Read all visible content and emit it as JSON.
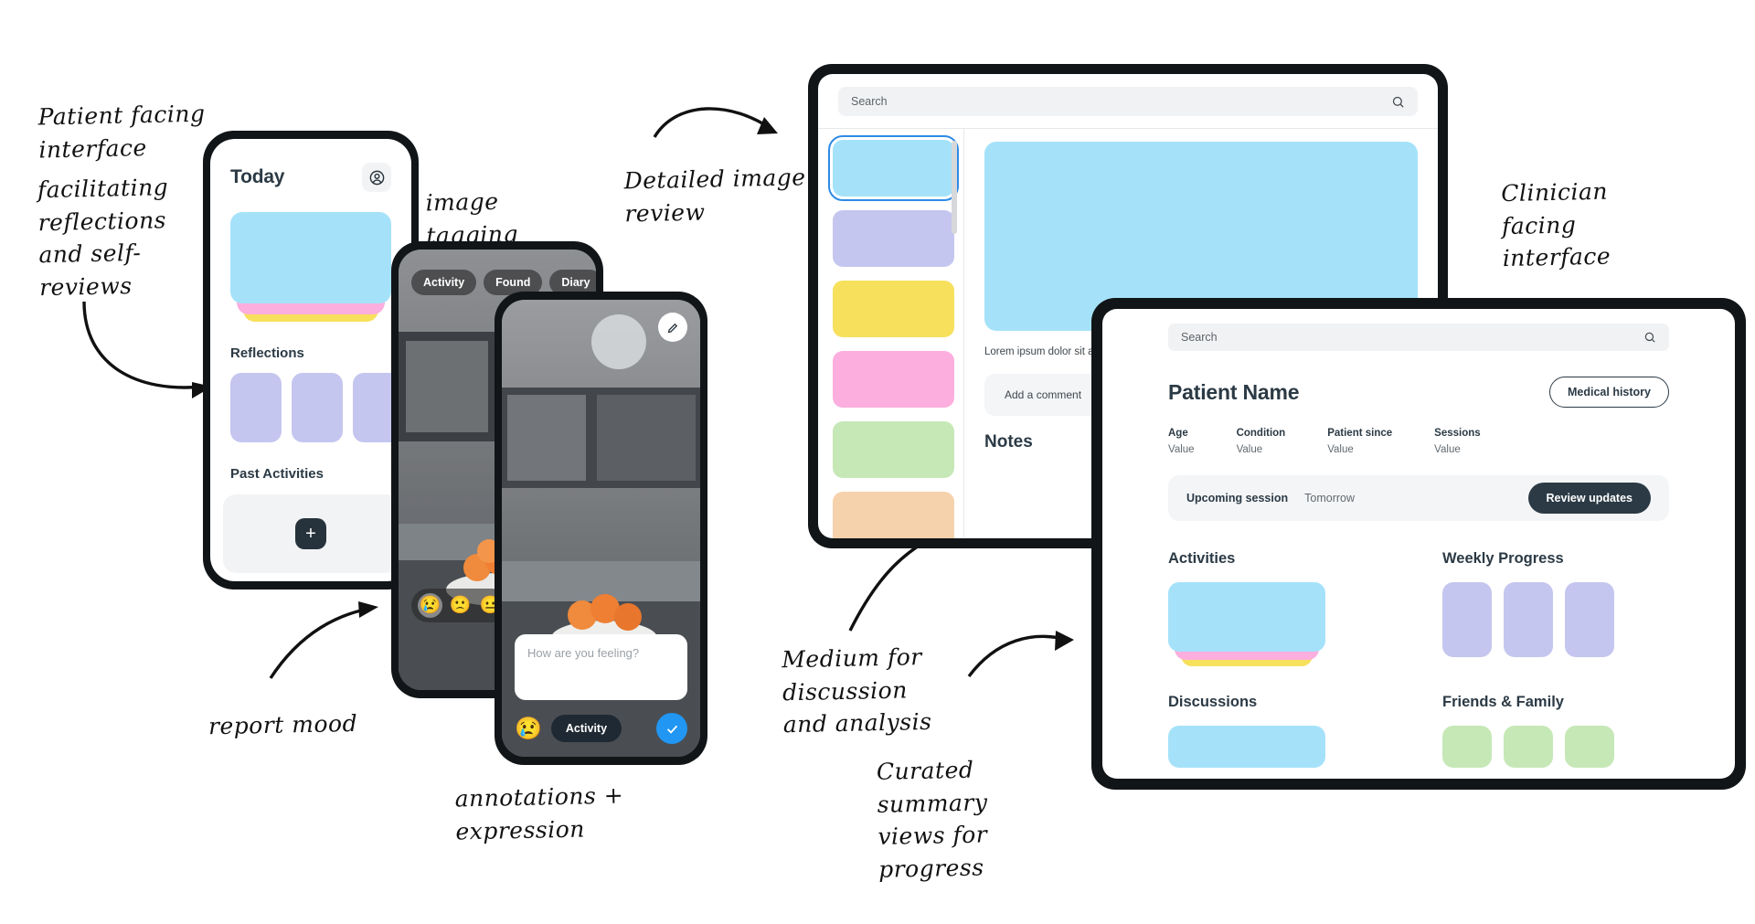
{
  "annotations": [
    {
      "id": "patient-facing",
      "text": "Patient facing\ninterface"
    },
    {
      "id": "facilitating",
      "text": "facilitating\nreflections\nand self-\nreviews"
    },
    {
      "id": "image-tagging",
      "text": "image\ntagging"
    },
    {
      "id": "report-mood",
      "text": "report mood"
    },
    {
      "id": "annotations-expression",
      "text": "annotations + expression"
    },
    {
      "id": "detailed-image-review",
      "text": "Detailed image\nreview"
    },
    {
      "id": "clinician-facing",
      "text": "Clinician\nfacing\ninterface"
    },
    {
      "id": "medium-discussion",
      "text": "Medium for\ndiscussion\nand analysis"
    },
    {
      "id": "curated-summary",
      "text": "Curated\nsummary\nviews for\nprogress"
    }
  ],
  "phone_today": {
    "title": "Today",
    "avatar_icon": "user-circle-icon",
    "reflections_title": "Reflections",
    "reflections": [
      {
        "color": "#c5c6ef"
      },
      {
        "color": "#c5c6ef"
      },
      {
        "color": "#c5c6ef"
      }
    ],
    "past_activities_title": "Past Activities",
    "add_label": "+",
    "stack_colors": {
      "top": "#a5e2fa",
      "middle": "#fcaede",
      "bottom": "#f7e05c"
    }
  },
  "phone_tagging": {
    "tags": [
      {
        "label": "Activity"
      },
      {
        "label": "Found"
      },
      {
        "label": "Diary"
      }
    ],
    "moods": [
      {
        "emoji": "😢",
        "name": "crying-face-emoji",
        "selected": true
      },
      {
        "emoji": "🙁",
        "name": "frowning-face-emoji",
        "selected": false
      },
      {
        "emoji": "😐",
        "name": "neutral-face-emoji",
        "selected": false
      }
    ]
  },
  "phone_note": {
    "edit_icon": "pencil-icon",
    "placeholder": "How are you feeling?",
    "mood_emoji": "😢",
    "activity_label": "Activity",
    "confirm_icon": "check-icon"
  },
  "tablet_review": {
    "search": {
      "placeholder": "Search",
      "icon": "search-icon"
    },
    "thumbnails": [
      {
        "color": "#a5e2fa",
        "selected": true
      },
      {
        "color": "#c5c6ef",
        "selected": false
      },
      {
        "color": "#f7e05c",
        "selected": false
      },
      {
        "color": "#fcaede",
        "selected": false
      },
      {
        "color": "#c6e8b6",
        "selected": false
      },
      {
        "color": "#f6d2ac",
        "selected": false
      }
    ],
    "hero_color": "#a5e2fa",
    "body_text": "Lorem ipsum dolor sit amet. Morbi condimentum eget nisl luctus.",
    "comment_placeholder": "Add a comment",
    "notes_title": "Notes"
  },
  "tablet_clinician": {
    "search": {
      "placeholder": "Search",
      "icon": "search-icon"
    },
    "patient_name": "Patient Name",
    "medical_history_label": "Medical history",
    "stats": [
      {
        "label": "Age",
        "value": "Value"
      },
      {
        "label": "Condition",
        "value": "Value"
      },
      {
        "label": "Patient since",
        "value": "Value"
      },
      {
        "label": "Sessions",
        "value": "Value"
      }
    ],
    "session": {
      "label": "Upcoming session",
      "value": "Tomorrow",
      "button": "Review updates"
    },
    "sections": {
      "activities": "Activities",
      "weekly_progress": "Weekly Progress",
      "discussions": "Discussions",
      "friends_family": "Friends & Family"
    },
    "weekly_bars": [
      {
        "color": "#c5c6ef"
      },
      {
        "color": "#c5c6ef"
      },
      {
        "color": "#c5c6ef"
      }
    ],
    "family_cards": [
      {
        "color": "#c6e8b6"
      },
      {
        "color": "#c6e8b6"
      },
      {
        "color": "#c6e8b6"
      }
    ]
  }
}
